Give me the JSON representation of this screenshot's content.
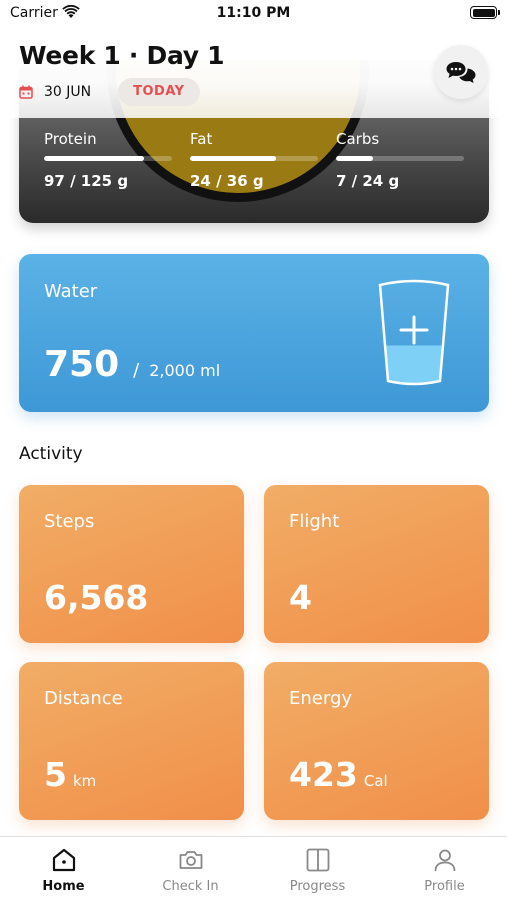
{
  "status": {
    "carrier": "Carrier",
    "time": "11:10 PM"
  },
  "header": {
    "title": "Week 1 · Day 1",
    "date": "30 JUN",
    "today_label": "TODAY"
  },
  "nutrition": {
    "macros": [
      {
        "label": "Protein",
        "value": "97 / 125 g",
        "progress": 0.78
      },
      {
        "label": "Fat",
        "value": "24 / 36 g",
        "progress": 0.67
      },
      {
        "label": "Carbs",
        "value": "7 / 24 g",
        "progress": 0.29
      }
    ]
  },
  "water": {
    "title": "Water",
    "amount": "750",
    "separator": "/",
    "goal": "2,000 ml",
    "fill_level": 0.375
  },
  "activity": {
    "title": "Activity",
    "tiles": [
      {
        "label": "Steps",
        "value": "6,568",
        "unit": ""
      },
      {
        "label": "Flight",
        "value": "4",
        "unit": ""
      },
      {
        "label": "Distance",
        "value": "5",
        "unit": "km"
      },
      {
        "label": "Energy",
        "value": "423",
        "unit": "Cal"
      }
    ]
  },
  "tabs": [
    {
      "label": "Home",
      "icon": "home-icon",
      "active": true
    },
    {
      "label": "Check In",
      "icon": "camera-icon",
      "active": false
    },
    {
      "label": "Progress",
      "icon": "progress-icon",
      "active": false
    },
    {
      "label": "Profile",
      "icon": "person-icon",
      "active": false
    }
  ],
  "colors": {
    "water": "#4aa6de",
    "activity": "#f39f58",
    "today_text": "#e45050"
  }
}
